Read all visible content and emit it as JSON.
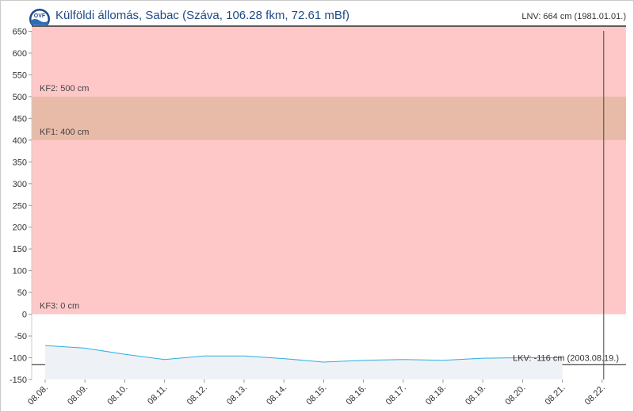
{
  "header": {
    "title": "Külföldi állomás, Sabac (Száva, 106.28 fkm, 72.61 mBf)",
    "lnv_label": "LNV: 664 cm (1981.01.01.)",
    "logo_text": "OVF"
  },
  "colors": {
    "title": "#1f4a86",
    "flood_zone": "#ffc8c8",
    "kf2_band": "#e8bba8",
    "series_line": "#2bb0e0",
    "area_fill": "#eef1f6",
    "reference_line": "#333333"
  },
  "chart_data": {
    "type": "line",
    "title": "",
    "xlabel": "",
    "ylabel": "",
    "ylim": [
      -150,
      650
    ],
    "yticks": [
      650,
      600,
      550,
      500,
      450,
      400,
      350,
      300,
      250,
      200,
      150,
      100,
      50,
      0,
      -50,
      -100,
      -150
    ],
    "categories": [
      "08.08.",
      "08.09.",
      "08.10.",
      "08.11.",
      "08.12.",
      "08.13.",
      "08.14.",
      "08.15.",
      "08.16.",
      "08.17.",
      "08.18.",
      "08.19.",
      "08.20.",
      "08.21.",
      "08.22."
    ],
    "series": [
      {
        "name": "",
        "values": [
          -72,
          -78,
          -92,
          -104,
          -96,
          -96,
          -102,
          -110,
          -106,
          -104,
          -106,
          -101,
          -100,
          -100,
          null
        ]
      }
    ],
    "zones": [
      {
        "label": "KF3: 0 cm",
        "from": 0,
        "to": 664
      },
      {
        "label": "KF2: 500 cm",
        "from": 400,
        "to": 500
      },
      {
        "label": "KF1: 400 cm",
        "value": 400
      }
    ],
    "reference_lines": [
      {
        "label": "LKV: -116 cm (2003.08.19.)",
        "value": -116
      }
    ],
    "current_time_marker": "08.22."
  }
}
